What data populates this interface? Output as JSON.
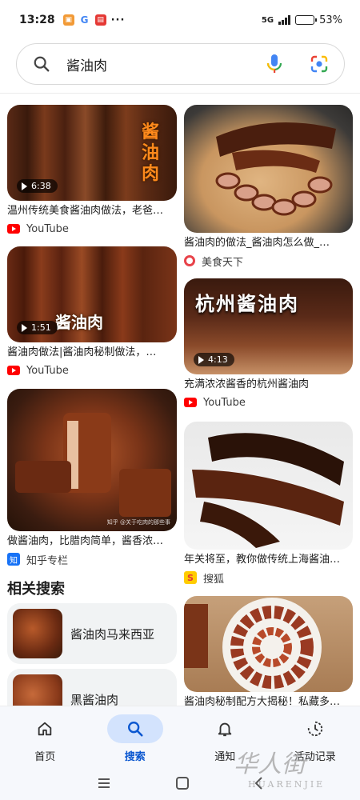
{
  "status": {
    "time": "13:28",
    "network": "5G",
    "battery": "53%",
    "battery_level": 0.53,
    "dots": "···",
    "g_icon": "G"
  },
  "search": {
    "query": "酱油肉"
  },
  "results": [
    {
      "title": "温州传统美食酱油肉做法，老爸…",
      "source": "YouTube",
      "duration": "6:38",
      "overlay": "酱油肉"
    },
    {
      "title": "酱油肉的做法_酱油肉怎么做_…",
      "source": "美食天下"
    },
    {
      "title": "酱油肉做法|酱油肉秘制做法，…",
      "source": "YouTube",
      "duration": "1:51",
      "overlay": "酱油肉"
    },
    {
      "title": "充满浓浓酱香的杭州酱油肉",
      "source": "YouTube",
      "duration": "4:13",
      "overlay": "杭州酱油肉"
    },
    {
      "title": "做酱油肉，比腊肉简单，酱香浓…",
      "source": "知乎专栏",
      "source_icon_text": "知",
      "caption": "知乎 @关于吃肉的那些事"
    },
    {
      "title": "年关将至，教你做传统上海酱油…",
      "source": "搜狐",
      "source_icon_text": "S"
    },
    {
      "title": "酱油肉秘制配方大揭秘！私藏多…"
    }
  ],
  "related": {
    "heading": "相关搜索",
    "items": [
      {
        "label": "酱油肉马来西亚"
      },
      {
        "label": "黑酱油肉"
      }
    ]
  },
  "nav": {
    "items": [
      {
        "label": "首页"
      },
      {
        "label": "搜索"
      },
      {
        "label": "通知"
      },
      {
        "label": "活动记录"
      }
    ],
    "active": "搜索"
  },
  "watermark": {
    "text": "华人街",
    "sub": "HUARENJIE"
  },
  "colors": {
    "accent": "#0b57d0",
    "nav_active_bg": "#d3e3fd",
    "youtube": "#ff0000"
  }
}
